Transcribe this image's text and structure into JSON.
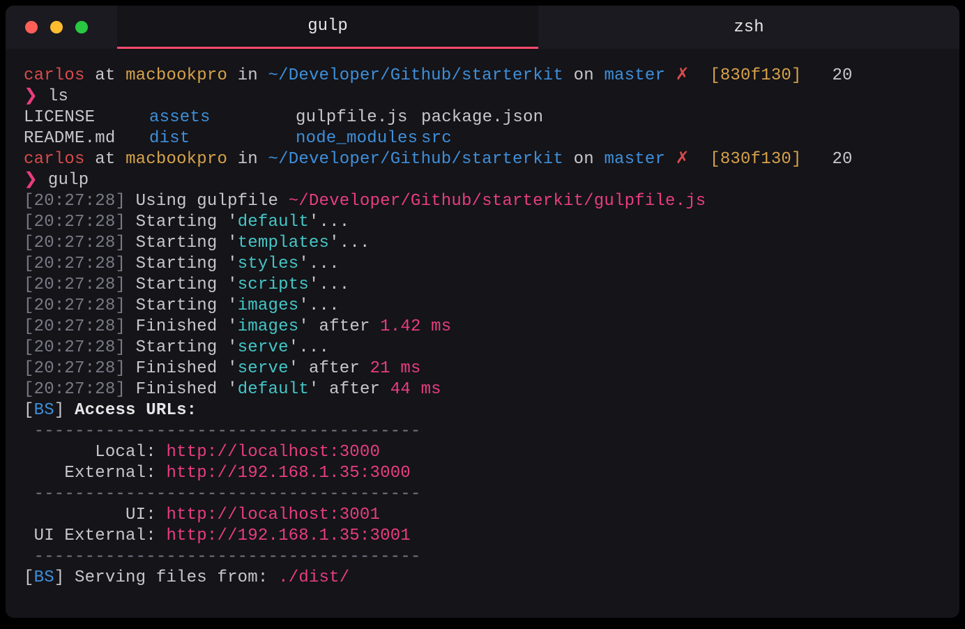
{
  "tabs": {
    "active": "gulp",
    "inactive": "zsh"
  },
  "prompt": {
    "user": "carlos",
    "at": "at",
    "host": "macbookpro",
    "in": "in",
    "path": "~/Developer/Github/starterkit",
    "on": "on",
    "branch": "master",
    "dirty": "✗",
    "hash_open": "[",
    "hash": "830f130",
    "hash_close": "]",
    "right": "20",
    "symbol": "❯"
  },
  "cmd1": "ls",
  "ls": {
    "r1": {
      "c1": "LICENSE",
      "c2": "assets",
      "c3": "gulpfile.js",
      "c4": "package.json"
    },
    "r2": {
      "c1": "README.md",
      "c2": "dist",
      "c3": "node_modules",
      "c4": "src"
    }
  },
  "cmd2": "gulp",
  "gulp": {
    "ts": "20:27:28",
    "using": "Using gulpfile",
    "gulpfile": "~/Developer/Github/starterkit/gulpfile.js",
    "starting": "Starting",
    "finished": "Finished",
    "after": "after",
    "dots": "...",
    "tasks": {
      "default": "default",
      "templates": "templates",
      "styles": "styles",
      "scripts": "scripts",
      "images": "images",
      "serve": "serve"
    },
    "durations": {
      "images": "1.42 ms",
      "serve": "21 ms",
      "default": "44 ms"
    }
  },
  "bs": {
    "tag": "BS",
    "header": "Access URLs:",
    "sep": " --------------------------------------",
    "labels": {
      "local": "       Local:",
      "external": "    External:",
      "ui": "          UI:",
      "ui_external": " UI External:"
    },
    "urls": {
      "local": "http://localhost:3000",
      "external": "http://192.168.1.35:3000",
      "ui": "http://localhost:3001",
      "ui_external": "http://192.168.1.35:3001"
    },
    "serving_label": "Serving files from:",
    "serving_path": "./dist/"
  }
}
